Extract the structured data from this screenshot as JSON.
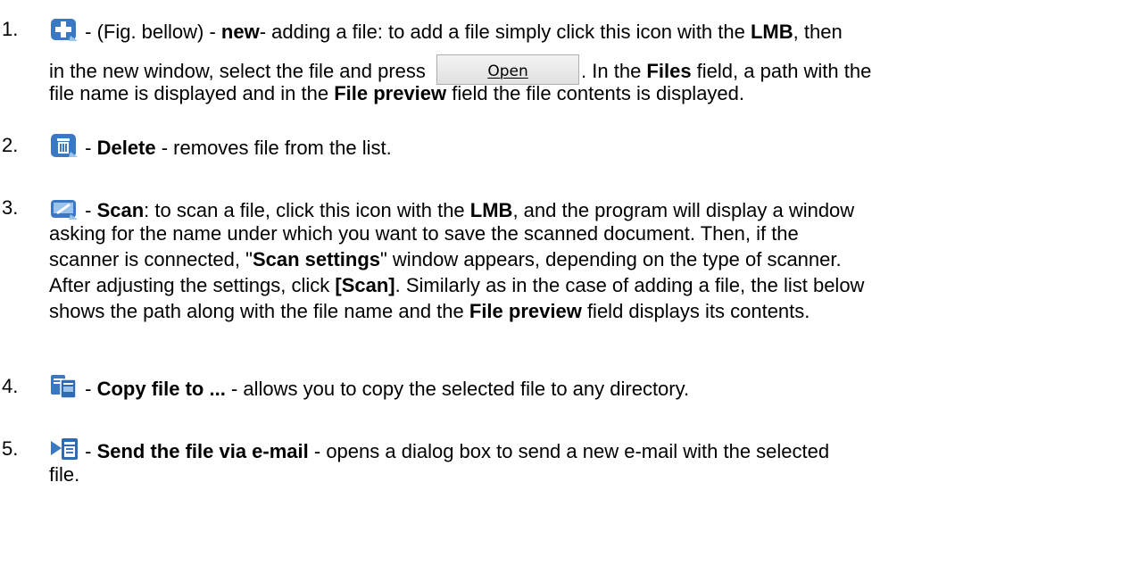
{
  "items": [
    {
      "number": "1.",
      "icon": "new-file-plus-icon",
      "lines": [
        [
          "- (Fig. bellow) - ",
          {
            "b": "new"
          },
          "- adding a file: to add a file simply click this icon with the ",
          {
            "b": "LMB"
          },
          ", then"
        ],
        [
          "in the new window, select the file and press ",
          {
            "button": "Open"
          },
          ". In the ",
          {
            "b": "Files"
          },
          " field, a path with the"
        ],
        [
          "file name is displayed and in the ",
          {
            "b": "File preview"
          },
          " field the file contents is displayed."
        ]
      ]
    },
    {
      "number": "2.",
      "icon": "delete-trash-icon",
      "lines": [
        [
          "- ",
          {
            "b": "Delete"
          },
          " - removes file from the list."
        ]
      ]
    },
    {
      "number": "3.",
      "icon": "scan-icon",
      "lines": [
        [
          "- ",
          {
            "b": "Scan"
          },
          ": to scan a file, click this icon with the ",
          {
            "b": "LMB"
          },
          ", and the program will display a window"
        ],
        [
          "asking for the name under which you want to save the scanned document. Then, if the"
        ],
        [
          "scanner is connected, \"",
          {
            "b": "Scan settings"
          },
          "\" window appears, depending on the type of scanner."
        ],
        [
          "After adjusting the settings, click ",
          {
            "b": "[Scan]"
          },
          ". Similarly as in the case of adding a file, the list below"
        ],
        [
          "shows the path along with the file name and the ",
          {
            "b": "File preview"
          },
          " field displays its contents."
        ]
      ]
    },
    {
      "number": "4.",
      "icon": "copy-file-icon",
      "lines": [
        [
          "- ",
          {
            "b": "Copy file to ..."
          },
          " - allows you to copy the selected file to any directory."
        ]
      ]
    },
    {
      "number": "5.",
      "icon": "send-email-icon",
      "lines": [
        [
          "- ",
          {
            "b": "Send the file via e-mail"
          },
          " - opens a dialog box to send a new e-mail with the selected"
        ],
        [
          "file."
        ]
      ]
    }
  ],
  "colors": {
    "icon_blue": "#3a78c2",
    "icon_light_blue": "#9cc4ea",
    "text": "#000000"
  }
}
